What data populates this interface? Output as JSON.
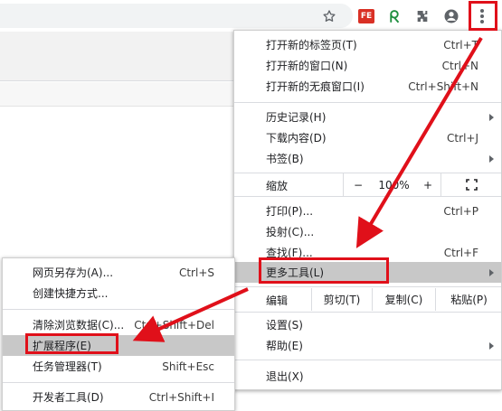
{
  "colors": {
    "accent": "#e0101a",
    "highlight": "#c8c8c8",
    "menu_bg": "#ffffff"
  },
  "toolbar": {
    "icons": [
      "star-icon",
      "fe-extension-icon",
      "extension-green-icon",
      "puzzle-icon",
      "profile-icon",
      "kebab-menu-icon"
    ],
    "fe_badge": "FE"
  },
  "main_menu": {
    "new_tab": {
      "label": "打开新的标签页(T)",
      "shortcut": "Ctrl+T"
    },
    "new_window": {
      "label": "打开新的窗口(N)",
      "shortcut": "Ctrl+N"
    },
    "incognito": {
      "label": "打开新的无痕窗口(I)",
      "shortcut": "Ctrl+Shift+N"
    },
    "history": {
      "label": "历史记录(H)"
    },
    "downloads": {
      "label": "下载内容(D)",
      "shortcut": "Ctrl+J"
    },
    "bookmarks": {
      "label": "书签(B)"
    },
    "zoom": {
      "label": "缩放",
      "minus": "−",
      "value": "100%",
      "plus": "+"
    },
    "print": {
      "label": "打印(P)...",
      "shortcut": "Ctrl+P"
    },
    "cast": {
      "label": "投射(C)..."
    },
    "find": {
      "label": "查找(F)...",
      "shortcut": "Ctrl+F"
    },
    "more_tools": {
      "label": "更多工具(L)"
    },
    "edit": {
      "label": "编辑",
      "cut": "剪切(T)",
      "copy": "复制(C)",
      "paste": "粘贴(P)"
    },
    "settings": {
      "label": "设置(S)"
    },
    "help": {
      "label": "帮助(E)"
    },
    "exit": {
      "label": "退出(X)"
    }
  },
  "sub_menu": {
    "save_page": {
      "label": "网页另存为(A)...",
      "shortcut": "Ctrl+S"
    },
    "create_shortcut": {
      "label": "创建快捷方式..."
    },
    "clear_data": {
      "label": "清除浏览数据(C)...",
      "shortcut": "Ctrl+Shift+Del"
    },
    "extensions": {
      "label": "扩展程序(E)"
    },
    "task_manager": {
      "label": "任务管理器(T)",
      "shortcut": "Shift+Esc"
    },
    "dev_tools": {
      "label": "开发者工具(D)",
      "shortcut": "Ctrl+Shift+I"
    }
  }
}
